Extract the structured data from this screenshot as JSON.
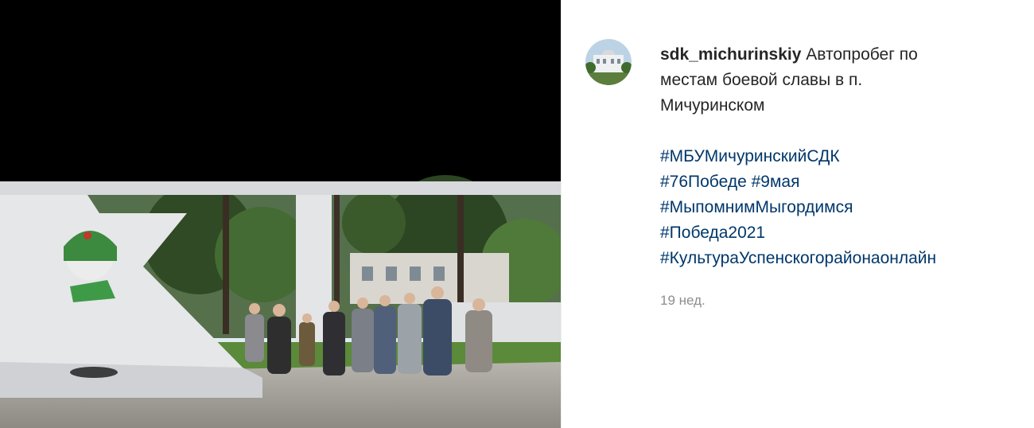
{
  "post": {
    "username": "sdk_michurinskiy",
    "caption_lines": [
      "Автопробег по",
      "местам боевой славы в п.",
      "Мичуринском"
    ],
    "hashtags": [
      "#МБУМичуринскийСДК",
      "#76Победе",
      "#9мая",
      "#МыпомнимМыгордимся",
      "#Победа2021",
      "#КультураУспенскогорайонаонлайн"
    ],
    "time_ago": "19 нед."
  },
  "colors": {
    "hashtag": "#00376b",
    "username": "#262626",
    "time": "#8e8e8e",
    "media_background": "#000000"
  },
  "icons": {
    "avatar": "profile-photo-building"
  }
}
